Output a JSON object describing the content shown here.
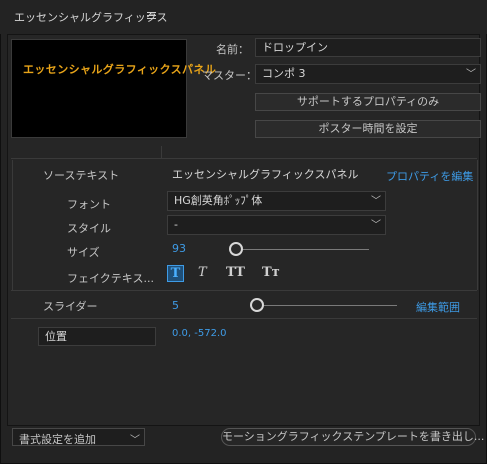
{
  "panel": {
    "title": "エッセンシャルグラフィックス"
  },
  "preview": {
    "text": "エッセンシャルグラフィックスパネル"
  },
  "info": {
    "name_label": "名前：",
    "name_value": "ドロップイン",
    "master_label": "マスター：",
    "master_value": "コンポ 3",
    "solo_props_button": "サポートするプロパティのみ",
    "poster_time_button": "ポスター時間を設定"
  },
  "source_text": {
    "label": "ソーステキスト",
    "value": "エッセンシャルグラフィックスパネル",
    "edit_link": "プロパティを編集"
  },
  "font": {
    "label": "フォント",
    "value": "HG創英角ﾎﾟｯﾌﾟ体"
  },
  "style": {
    "label": "スタイル",
    "value": "-"
  },
  "size": {
    "label": "サイズ",
    "value": "93",
    "fraction": 0.0
  },
  "faux": {
    "label": "フェイクテキス...",
    "buttons": [
      "T",
      "T",
      "TT",
      "Tт"
    ]
  },
  "slider_prop": {
    "label": "スライダー",
    "value": "5",
    "fraction": 0.05,
    "edit_range_link": "編集範囲"
  },
  "position": {
    "label": "位置",
    "value": "0.0, -572.0"
  },
  "footer": {
    "add_format_select": "書式設定を追加",
    "export_button": "モーショングラフィックステンプレートを書き出し..."
  },
  "colors": {
    "accent": "#3e9be6",
    "preview_text": "#e8a419"
  }
}
